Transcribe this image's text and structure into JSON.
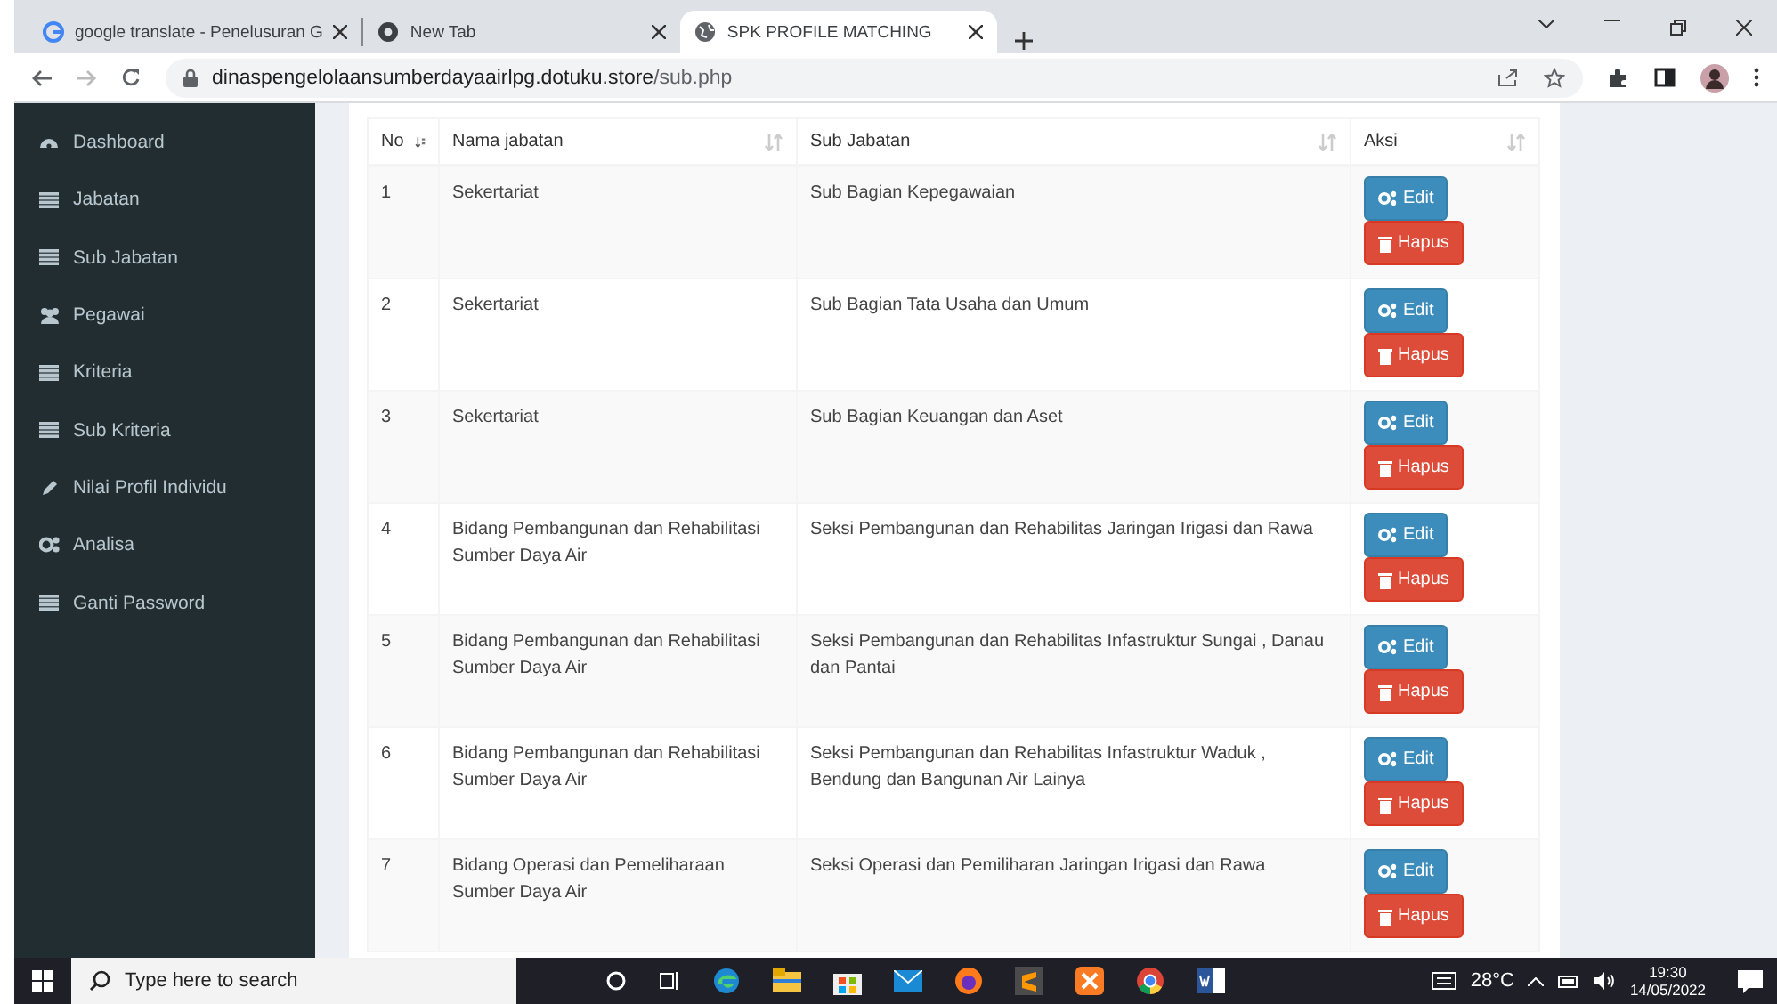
{
  "browser": {
    "tabs": [
      {
        "title": "google translate - Penelusuran G",
        "kind": "google",
        "selected": false
      },
      {
        "title": "New Tab",
        "kind": "chrome",
        "selected": false
      },
      {
        "title": "SPK PROFILE MATCHING",
        "kind": "globe",
        "selected": true
      }
    ],
    "url_host": "dinaspengelolaansumberdayaairlpg.dotuku.store",
    "url_path": "/sub.php"
  },
  "sidebar": {
    "items": [
      {
        "label": "Dashboard",
        "kind": "dashboard"
      },
      {
        "label": "Jabatan",
        "kind": "list"
      },
      {
        "label": "Sub Jabatan",
        "kind": "list"
      },
      {
        "label": "Pegawai",
        "kind": "users"
      },
      {
        "label": "Kriteria",
        "kind": "list"
      },
      {
        "label": "Sub Kriteria",
        "kind": "list"
      },
      {
        "label": "Nilai Profil Individu",
        "kind": "pencil"
      },
      {
        "label": "Analisa",
        "kind": "gears"
      },
      {
        "label": "Ganti Password",
        "kind": "list"
      }
    ]
  },
  "table": {
    "columns": [
      {
        "label": "No",
        "sorted": true
      },
      {
        "label": "Nama jabatan",
        "sorted": false
      },
      {
        "label": "Sub Jabatan",
        "sorted": false
      },
      {
        "label": "Aksi",
        "sorted": false
      }
    ],
    "rows": [
      {
        "no": "1",
        "nama": "Sekertariat",
        "sub": "Sub Bagian Kepegawaian",
        "edit": "Edit",
        "delete": "Hapus"
      },
      {
        "no": "2",
        "nama": "Sekertariat",
        "sub": "Sub Bagian Tata Usaha dan Umum",
        "edit": "Edit",
        "delete": "Hapus"
      },
      {
        "no": "3",
        "nama": "Sekertariat",
        "sub": "Sub Bagian Keuangan dan Aset",
        "edit": "Edit",
        "delete": "Hapus"
      },
      {
        "no": "4",
        "nama": "Bidang Pembangunan dan Rehabilitasi Sumber Daya Air",
        "sub": "Seksi Pembangunan dan Rehabilitas Jaringan Irigasi dan Rawa",
        "edit": "Edit",
        "delete": "Hapus"
      },
      {
        "no": "5",
        "nama": "Bidang Pembangunan dan Rehabilitasi Sumber Daya Air",
        "sub": "Seksi Pembangunan dan Rehabilitas Infastruktur Sungai , Danau dan Pantai",
        "edit": "Edit",
        "delete": "Hapus"
      },
      {
        "no": "6",
        "nama": "Bidang Pembangunan dan Rehabilitasi Sumber Daya Air",
        "sub": "Seksi Pembangunan dan Rehabilitas Infastruktur Waduk , Bendung dan Bangunan Air Lainya",
        "edit": "Edit",
        "delete": "Hapus"
      },
      {
        "no": "7",
        "nama": "Bidang Operasi dan Pemeliharaan Sumber Daya Air",
        "sub": "Seksi Operasi dan Pemiliharan Jaringan Irigasi dan Rawa",
        "edit": "Edit",
        "delete": "Hapus"
      }
    ]
  },
  "taskbar": {
    "search_placeholder": "Type here to search",
    "temperature": "28°C",
    "time": "19:30",
    "date": "14/05/2022"
  }
}
